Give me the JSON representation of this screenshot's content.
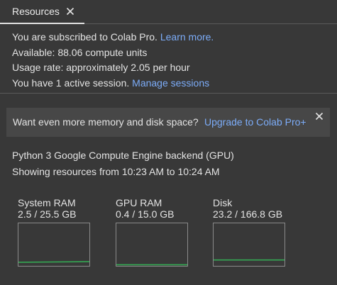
{
  "tab": {
    "title": "Resources",
    "close_icon": "close-icon"
  },
  "info": {
    "subscription_text": "You are subscribed to Colab Pro.",
    "learn_more": "Learn more.",
    "available": "Available: 88.06 compute units",
    "usage_rate": "Usage rate: approximately 2.05 per hour",
    "sessions_text": "You have 1 active session.",
    "manage_sessions": "Manage sessions"
  },
  "upgrade": {
    "text": "Want even more memory and disk space?",
    "link": "Upgrade to Colab Pro+",
    "close_icon": "close-icon"
  },
  "backend": {
    "line1": "Python 3 Google Compute Engine backend (GPU)",
    "line2": "Showing resources from 10:23 AM to 10:24 AM"
  },
  "meters": [
    {
      "title": "System RAM",
      "value": "2.5 / 25.5 GB",
      "fraction_start": 0.085,
      "fraction_end": 0.098
    },
    {
      "title": "GPU RAM",
      "value": "0.4 / 15.0 GB",
      "fraction_start": 0.027,
      "fraction_end": 0.027
    },
    {
      "title": "Disk",
      "value": "23.2 / 166.8 GB",
      "fraction_start": 0.139,
      "fraction_end": 0.139
    }
  ],
  "colors": {
    "background": "#383838",
    "link": "#7cacf8",
    "graph_line": "#34a853",
    "border": "#8a8a8a"
  }
}
